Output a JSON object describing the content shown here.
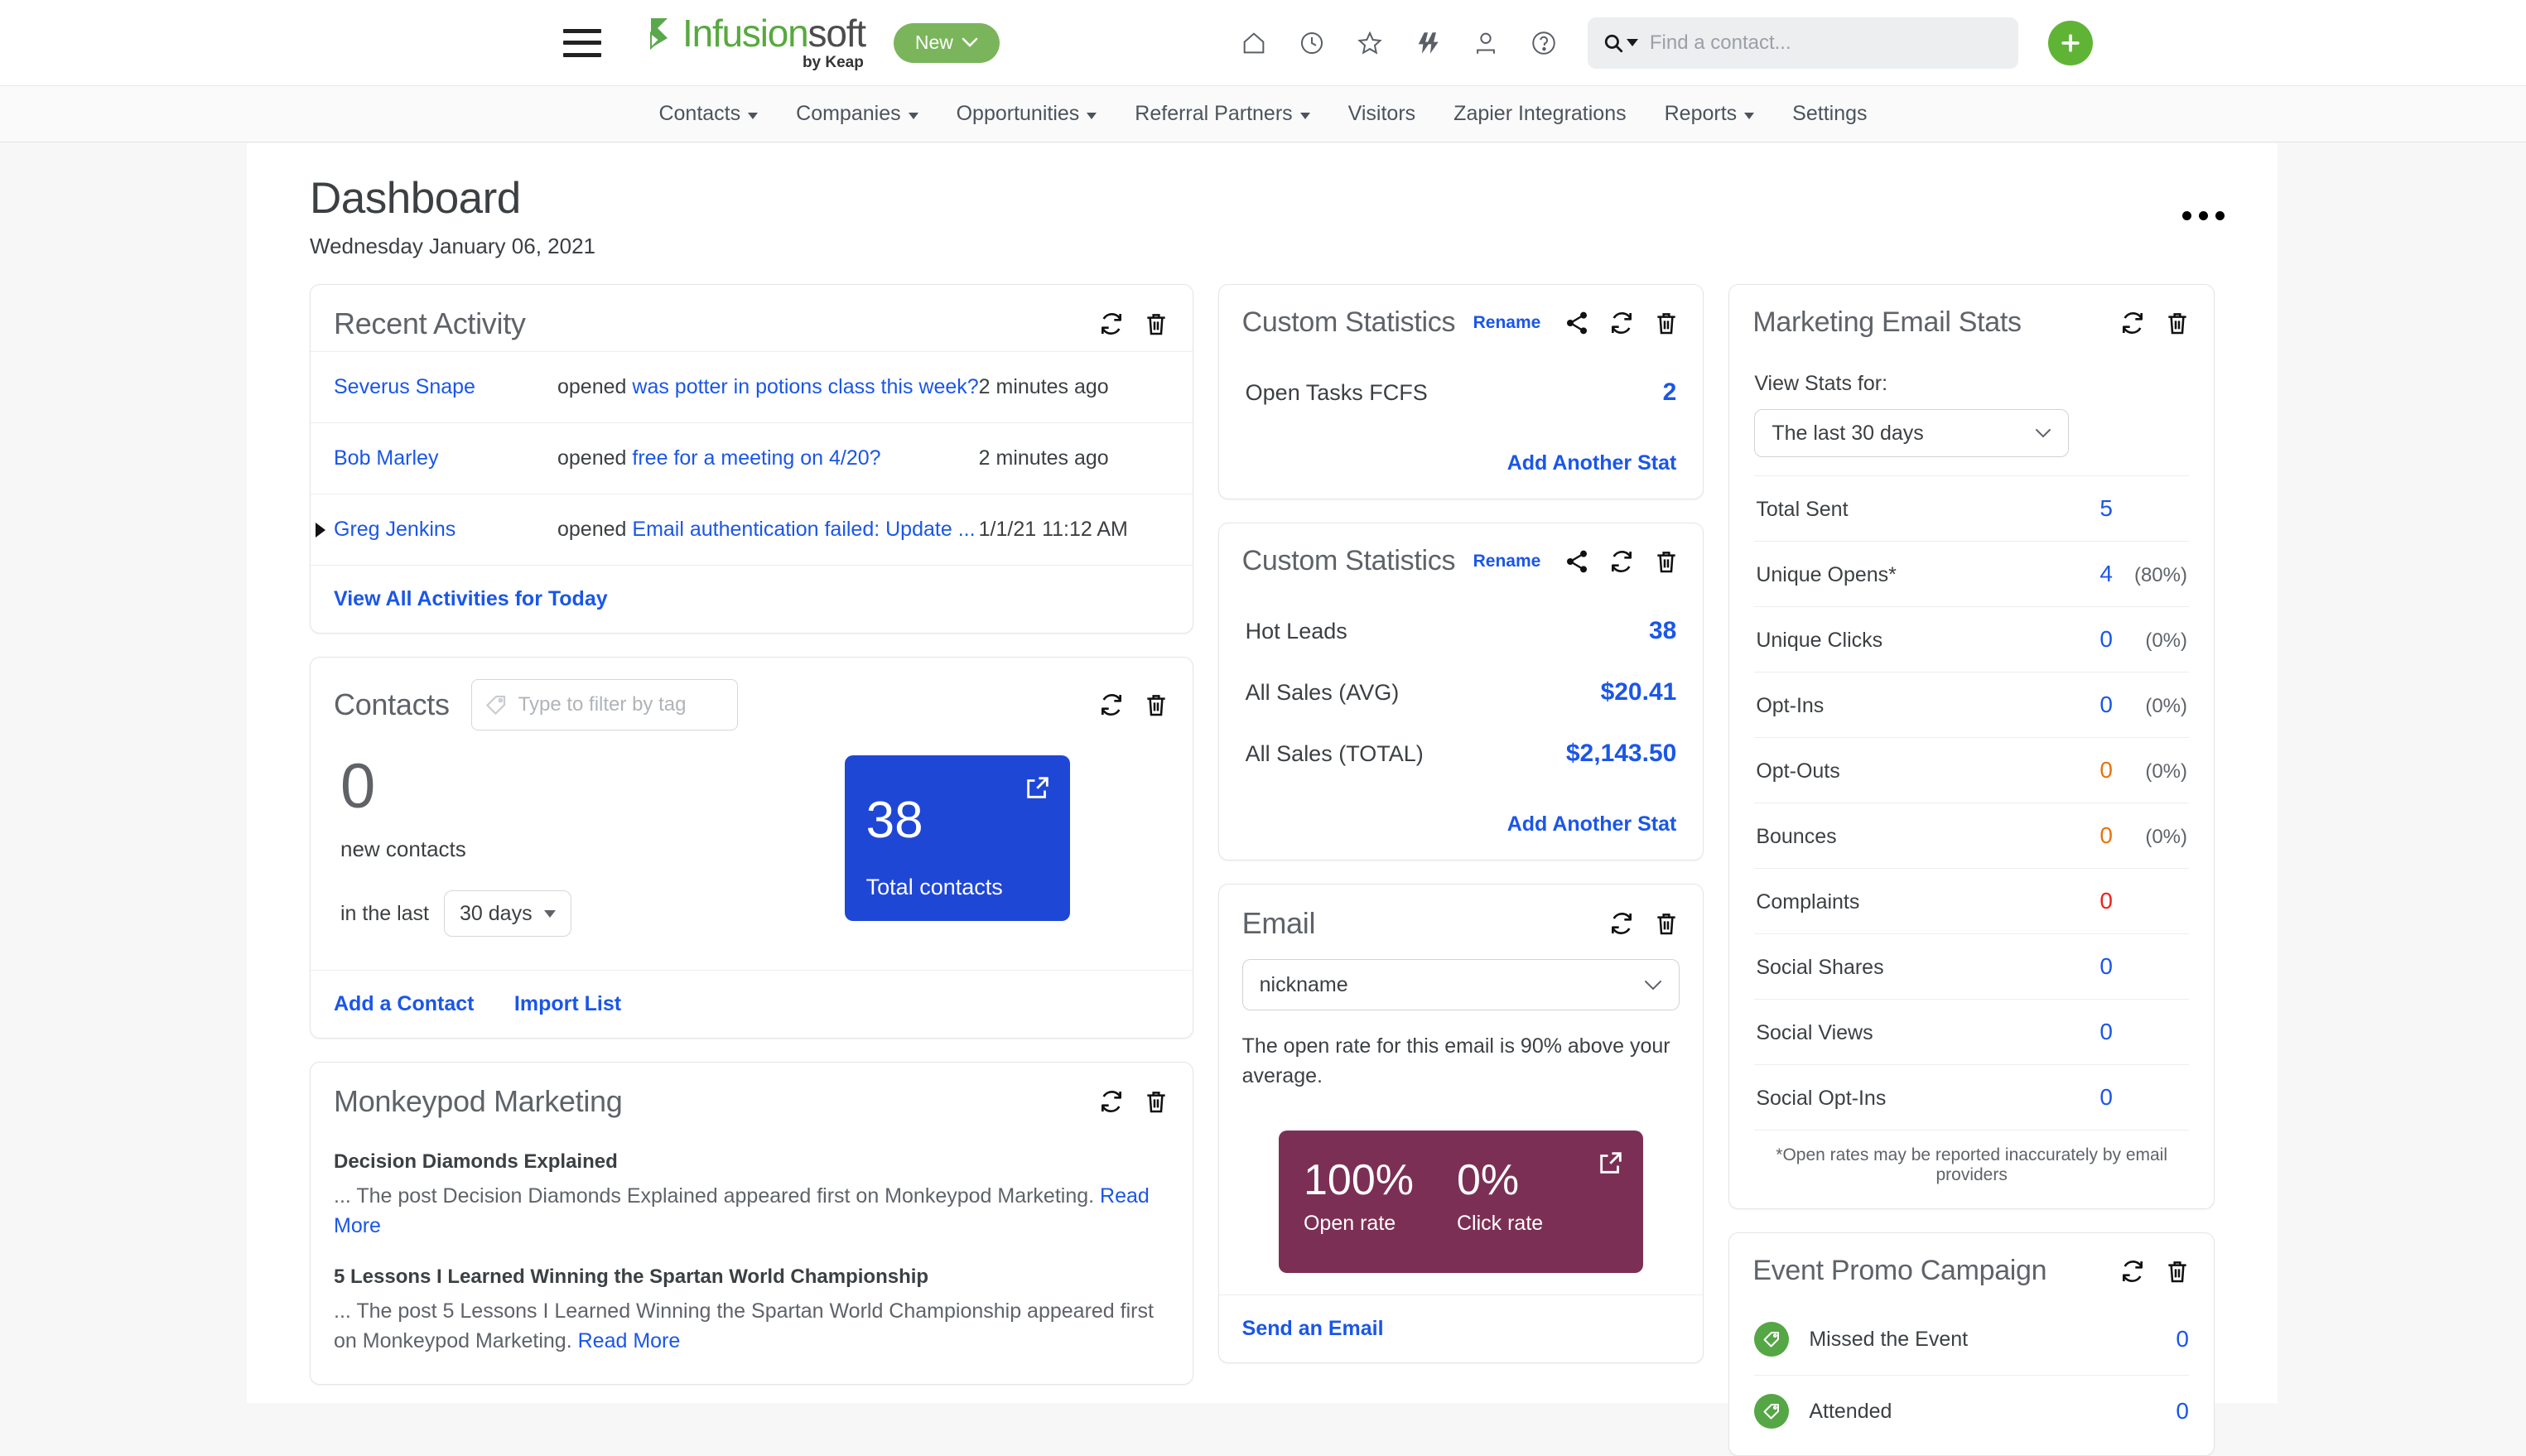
{
  "header": {
    "menu_icon": "hamburger-icon",
    "logo_primary": "Infusion",
    "logo_secondary": "soft",
    "logo_byline": "by Keap",
    "new_button": "New",
    "icons": [
      "home-icon",
      "clock-icon",
      "star-icon",
      "lightning-icon",
      "person-icon",
      "help-icon"
    ],
    "search_placeholder": "Find a contact...",
    "search_value": "",
    "add_button": "+"
  },
  "nav": {
    "items": [
      {
        "label": "Contacts",
        "has_chevron": true
      },
      {
        "label": "Companies",
        "has_chevron": true
      },
      {
        "label": "Opportunities",
        "has_chevron": true
      },
      {
        "label": "Referral Partners",
        "has_chevron": true
      },
      {
        "label": "Visitors",
        "has_chevron": false
      },
      {
        "label": "Zapier Integrations",
        "has_chevron": false
      },
      {
        "label": "Reports",
        "has_chevron": true
      },
      {
        "label": "Settings",
        "has_chevron": false
      }
    ]
  },
  "page": {
    "title": "Dashboard",
    "date": "Wednesday January 06, 2021",
    "more_menu": "more-options"
  },
  "recent_activity": {
    "title": "Recent Activity",
    "rows": [
      {
        "name": "Severus Snape",
        "verb": "opened",
        "subject": "was potter in potions class this week?",
        "time": "2 minutes ago",
        "marker": false
      },
      {
        "name": "Bob Marley",
        "verb": "opened",
        "subject": "free for a meeting on 4/20?",
        "time": "2 minutes ago",
        "marker": false
      },
      {
        "name": "Greg Jenkins",
        "verb": "opened",
        "subject": "Email authentication failed: Update ...",
        "time": "1/1/21 11:12 AM",
        "marker": true
      }
    ],
    "footer_link": "View All Activities for Today"
  },
  "contacts": {
    "title": "Contacts",
    "filter_placeholder": "Type to filter by tag",
    "filter_value": "",
    "new_count": "0",
    "new_label": "new contacts",
    "in_the_last": "in the last",
    "range": "30 days",
    "tile": {
      "value": "38",
      "label": "Total contacts",
      "color": "#1f47d6"
    },
    "links": [
      "Add a Contact",
      "Import List"
    ]
  },
  "monkeypod": {
    "title": "Monkeypod Marketing",
    "posts": [
      {
        "title": "Decision Diamonds Explained",
        "excerpt": "... The post Decision Diamonds Explained appeared first on Monkeypod Marketing. ",
        "read_more": "Read More"
      },
      {
        "title": "5 Lessons I Learned Winning the Spartan World Championship",
        "excerpt": "... The post 5 Lessons I Learned Winning the Spartan World Championship appeared first on Monkeypod Marketing. ",
        "read_more": "Read More"
      }
    ]
  },
  "custom_stats_1": {
    "title": "Custom Statistics",
    "rename": "Rename",
    "rows": [
      {
        "label": "Open Tasks FCFS",
        "value": "2"
      }
    ],
    "add_link": "Add Another Stat"
  },
  "custom_stats_2": {
    "title": "Custom Statistics",
    "rename": "Rename",
    "rows": [
      {
        "label": "Hot Leads",
        "value": "38"
      },
      {
        "label": "All Sales (AVG)",
        "value": "$20.41"
      },
      {
        "label": "All Sales (TOTAL)",
        "value": "$2,143.50"
      }
    ],
    "add_link": "Add Another Stat"
  },
  "email_card": {
    "title": "Email",
    "selected_email": "nickname",
    "note": "The open rate for this email is 90% above your average.",
    "tile": {
      "open_rate": "100%",
      "open_label": "Open rate",
      "click_rate": "0%",
      "click_label": "Click rate",
      "color": "#7c2f54"
    },
    "footer_link": "Send an Email"
  },
  "marketing_stats": {
    "title": "Marketing Email Stats",
    "view_label": "View Stats for:",
    "range": "The last 30 days",
    "rows": [
      {
        "label": "Total Sent",
        "value": "5",
        "pct": "",
        "color": "#1a56e8"
      },
      {
        "label": "Unique Opens*",
        "value": "4",
        "pct": "(80%)",
        "color": "#1a56e8"
      },
      {
        "label": "Unique Clicks",
        "value": "0",
        "pct": "(0%)",
        "color": "#1a56e8"
      },
      {
        "label": "Opt-Ins",
        "value": "0",
        "pct": "(0%)",
        "color": "#1a56e8"
      },
      {
        "label": "Opt-Outs",
        "value": "0",
        "pct": "(0%)",
        "color": "#e8730c"
      },
      {
        "label": "Bounces",
        "value": "0",
        "pct": "(0%)",
        "color": "#e8730c"
      },
      {
        "label": "Complaints",
        "value": "0",
        "pct": "",
        "color": "#ef2020"
      },
      {
        "label": "Social Shares",
        "value": "0",
        "pct": "",
        "color": "#1a56e8"
      },
      {
        "label": "Social Views",
        "value": "0",
        "pct": "",
        "color": "#1a56e8"
      },
      {
        "label": "Social Opt-Ins",
        "value": "0",
        "pct": "",
        "color": "#1a56e8"
      }
    ],
    "footnote": "*Open rates may be reported inaccurately by email providers"
  },
  "event_promo": {
    "title": "Event Promo Campaign",
    "rows": [
      {
        "label": "Missed the Event",
        "value": "0"
      },
      {
        "label": "Attended",
        "value": "0"
      }
    ]
  }
}
